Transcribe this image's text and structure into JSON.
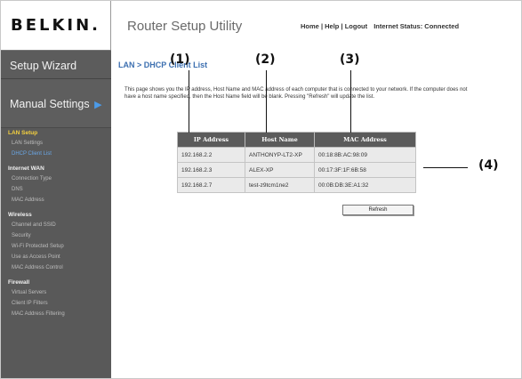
{
  "brand": {
    "logo_text": "BELKIN."
  },
  "header": {
    "title": "Router Setup Utility",
    "links": [
      "Home",
      "Help",
      "Logout"
    ],
    "separator": "|",
    "status": "Internet Status: Connected"
  },
  "sidebar": {
    "setup_wizard": "Setup Wizard",
    "manual_settings": "Manual Settings",
    "sections": [
      {
        "title": "LAN Setup",
        "items": [
          "LAN Settings",
          "DHCP Client List"
        ]
      },
      {
        "title": "Internet WAN",
        "items": [
          "Connection Type",
          "DNS",
          "MAC Address"
        ]
      },
      {
        "title": "Wireless",
        "items": [
          "Channel and SSID",
          "Security",
          "Wi-Fi Protected Setup",
          "Use as Access Point",
          "MAC Address Control"
        ]
      },
      {
        "title": "Firewall",
        "items": [
          "Virtual Servers",
          "Client IP Filters",
          "MAC Address Filtering"
        ]
      }
    ]
  },
  "main": {
    "breadcrumb": "LAN > DHCP Client List",
    "description": "This page shows you the IP address, Host Name and MAC address of each computer that is connected to your network. If the computer does not have a host name specified, then the Host Name field will be blank. Pressing \"Refresh\" will update the list.",
    "table": {
      "headers": [
        "IP Address",
        "Host Name",
        "MAC Address"
      ],
      "rows": [
        [
          "192.168.2.2",
          "ANTHONYP-LT2-XP",
          "00:18:8B:AC:98:09"
        ],
        [
          "192.168.2.3",
          "ALEX-XP",
          "00:17:3F:1F:6B:58"
        ],
        [
          "192.168.2.7",
          "test-z9tcm1ne2",
          "00:0B:DB:3E:A1:32"
        ]
      ]
    },
    "refresh_label": "Refresh"
  },
  "callouts": [
    "(1)",
    "(2)",
    "(3)",
    "(4)"
  ]
}
